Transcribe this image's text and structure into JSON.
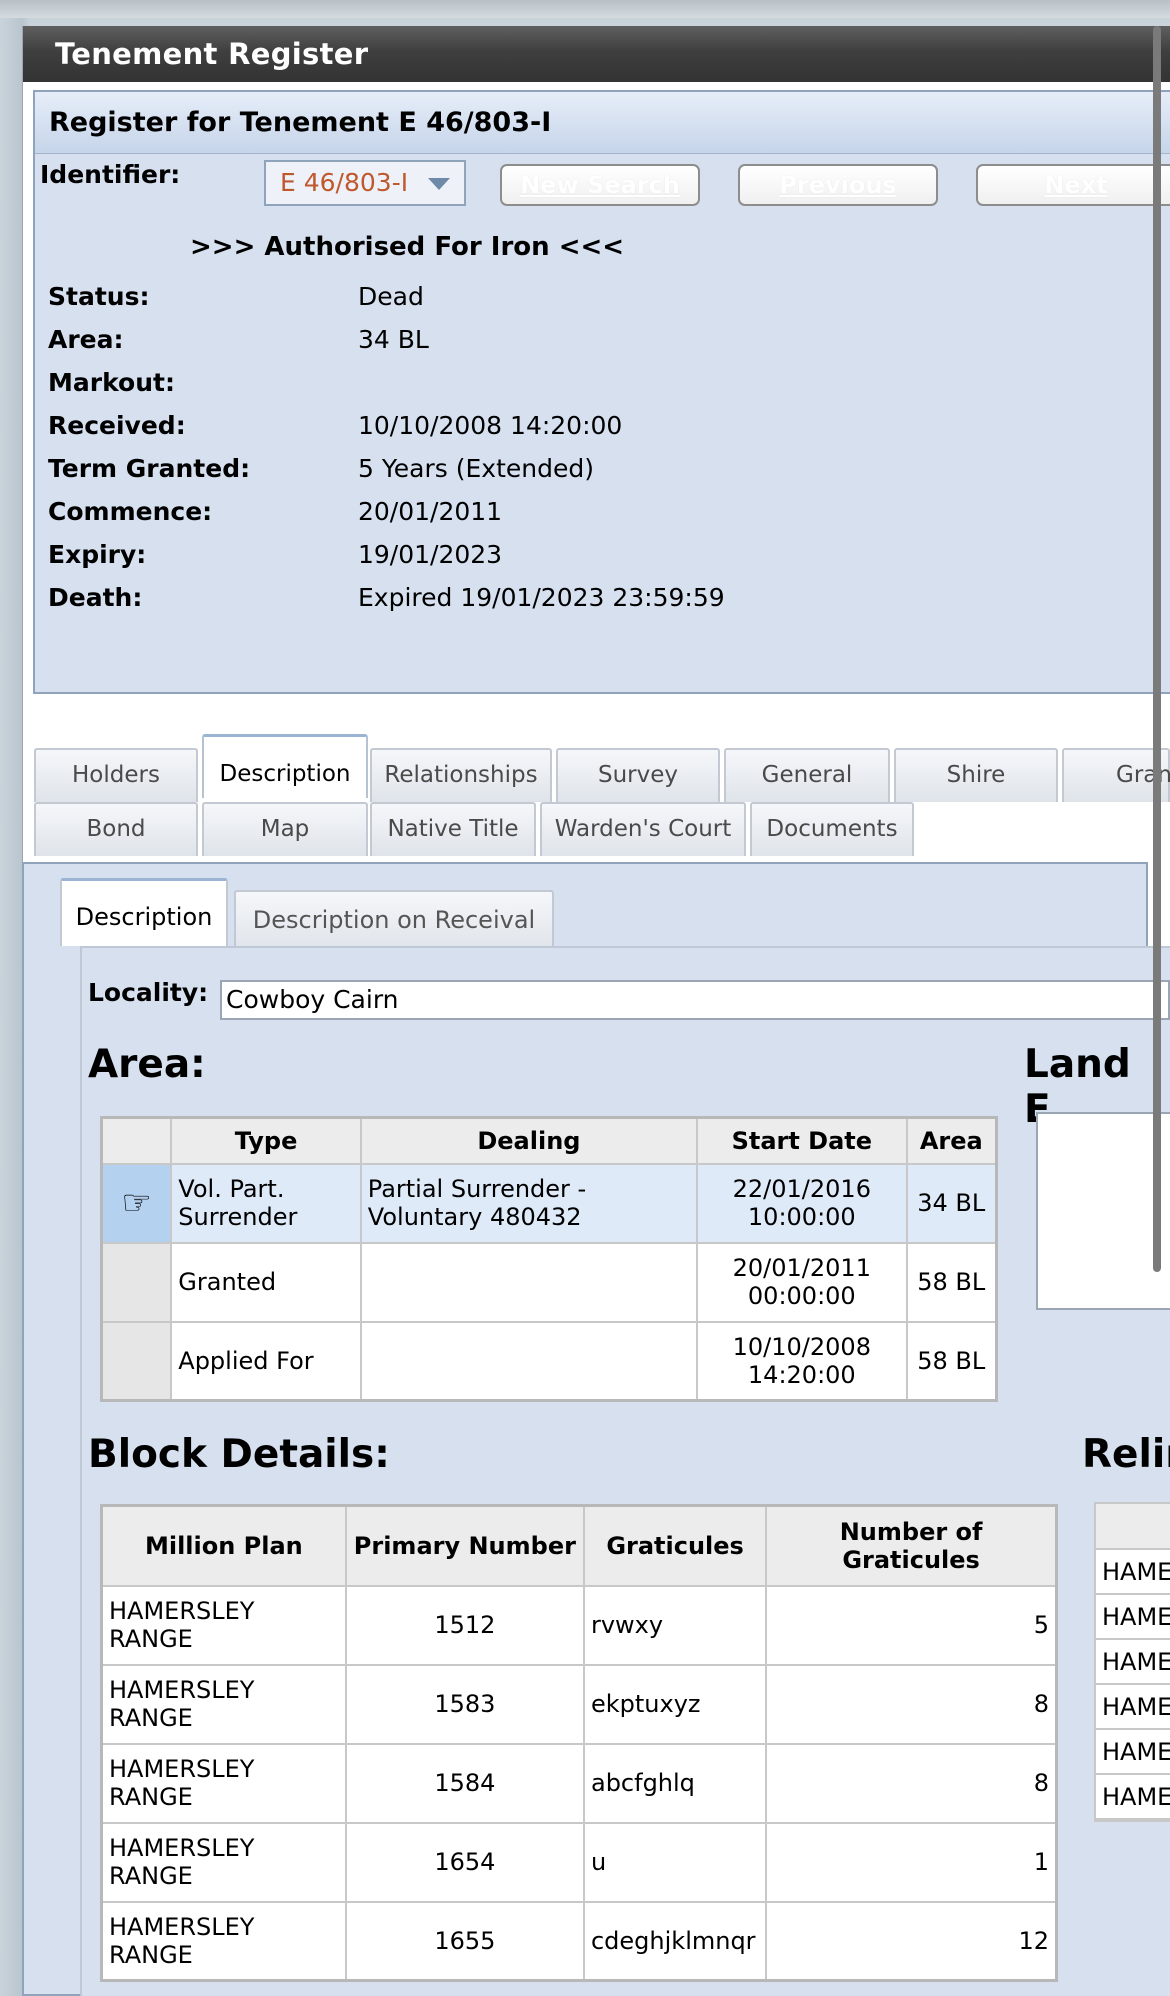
{
  "window": {
    "title": "Tenement Register"
  },
  "register": {
    "heading": "Register for Tenement E 46/803-I",
    "identifier_label": "Identifier:",
    "identifier_value": "E 46/803-I",
    "buttons": {
      "new_search": "New Search",
      "previous": "Previous",
      "next": "Next"
    },
    "authorised": ">>> Authorised For Iron <<<",
    "fields": {
      "status_label": "Status:",
      "status": "Dead",
      "area_label": "Area:",
      "area": "34 BL",
      "markout_label": "Markout:",
      "markout": "",
      "received_label": "Received:",
      "received": "10/10/2008 14:20:00",
      "term_label": "Term Granted:",
      "term": "5 Years (Extended)",
      "commence_label": "Commence:",
      "commence": "20/01/2011",
      "expiry_label": "Expiry:",
      "expiry": "19/01/2023",
      "death_label": "Death:",
      "death": "Expired 19/01/2023 23:59:59"
    }
  },
  "tabs": {
    "row1": [
      "Holders",
      "Description",
      "Relationships",
      "Survey",
      "General",
      "Shire",
      "Gran"
    ],
    "row2": [
      "Bond",
      "Map",
      "Native Title",
      "Warden's Court",
      "Documents"
    ],
    "active": "Description"
  },
  "subtabs": [
    "Description",
    "Description on Receival"
  ],
  "locality": {
    "label": "Locality:",
    "value": "Cowboy Cairn"
  },
  "area_section": {
    "heading": "Area:",
    "columns": [
      "Type",
      "Dealing",
      "Start Date",
      "Area"
    ],
    "rows": [
      {
        "type": "Vol. Part. Surrender",
        "dealing": "Partial Surrender - Voluntary 480432",
        "start_date": "22/01/2016 10:00:00",
        "area": "34 BL",
        "selected": true
      },
      {
        "type": "Granted",
        "dealing": "",
        "start_date": "20/01/2011 00:00:00",
        "area": "58 BL"
      },
      {
        "type": "Applied For",
        "dealing": "",
        "start_date": "10/10/2008 14:20:00",
        "area": "58 BL"
      }
    ]
  },
  "land_section": {
    "heading": "Land E"
  },
  "block_section": {
    "heading": "Block Details:",
    "columns": [
      "Million Plan",
      "Primary Number",
      "Graticules",
      "Number of Graticules"
    ],
    "rows": [
      {
        "plan": "HAMERSLEY RANGE",
        "primary": "1512",
        "graticules": "rvwxy",
        "count": "5"
      },
      {
        "plan": "HAMERSLEY RANGE",
        "primary": "1583",
        "graticules": "ekptuxyz",
        "count": "8"
      },
      {
        "plan": "HAMERSLEY RANGE",
        "primary": "1584",
        "graticules": "abcfghlq",
        "count": "8"
      },
      {
        "plan": "HAMERSLEY RANGE",
        "primary": "1654",
        "graticules": "u",
        "count": "1"
      },
      {
        "plan": "HAMERSLEY RANGE",
        "primary": "1655",
        "graticules": "cdeghjklmnqr",
        "count": "12"
      }
    ]
  },
  "relin_section": {
    "heading": "Relin",
    "rows": [
      "HAME",
      "HAME",
      "HAME",
      "HAME",
      "HAME",
      "HAME"
    ]
  }
}
